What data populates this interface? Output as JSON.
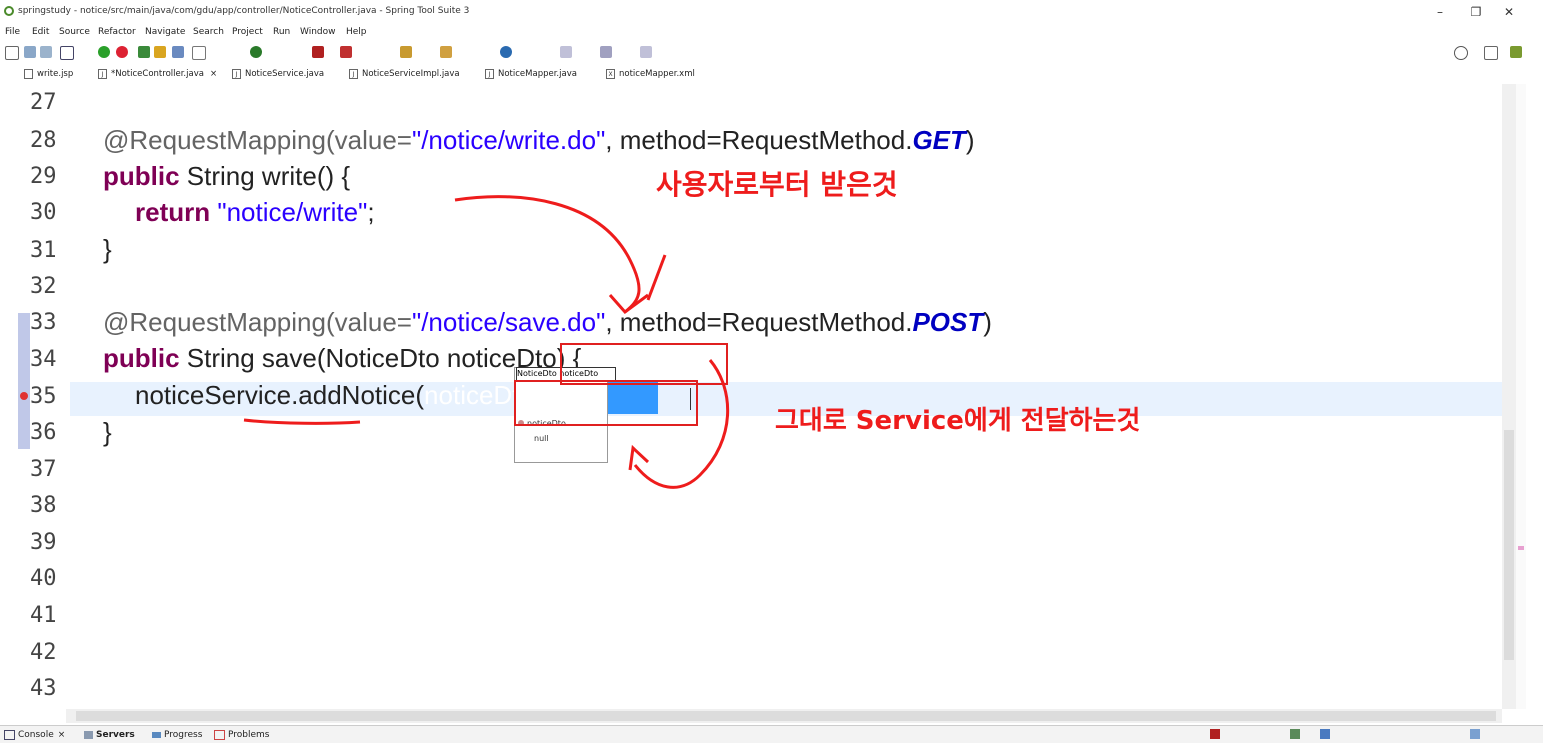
{
  "window": {
    "title": "springstudy - notice/src/main/java/com/gdu/app/controller/NoticeController.java - Spring Tool Suite 3",
    "controls": [
      "–",
      "❐",
      "✕"
    ]
  },
  "menu": [
    "File",
    "Edit",
    "Source",
    "Refactor",
    "Navigate",
    "Search",
    "Project",
    "Run",
    "Window",
    "Help"
  ],
  "tabs": [
    {
      "label": "write.jsp",
      "icon": "jsp-file-icon"
    },
    {
      "label": "*NoticeController.java",
      "icon": "java-file-icon",
      "close": "×"
    },
    {
      "label": "NoticeService.java",
      "icon": "java-file-icon"
    },
    {
      "label": "NoticeServiceImpl.java",
      "icon": "java-file-icon"
    },
    {
      "label": "NoticeMapper.java",
      "icon": "java-file-icon"
    },
    {
      "label": "noticeMapper.xml",
      "icon": "xml-file-icon"
    }
  ],
  "editor": {
    "line_numbers": [
      "27",
      "28",
      "29",
      "30",
      "31",
      "32",
      "33",
      "34",
      "35",
      "36",
      "37",
      "38",
      "39",
      "40",
      "41",
      "42",
      "43"
    ],
    "lines": {
      "l28": {
        "a": "@RequestMapping(value=",
        "s": "\"/notice/write.do\"",
        "b": ", method=RequestMethod.",
        "e": "GET",
        "c": ")"
      },
      "l29": {
        "k": "public",
        "rest": " String write() {"
      },
      "l30": {
        "k": "return",
        "s": "\"notice/write\"",
        "c": ";"
      },
      "l31": {
        "c": "}"
      },
      "l33": {
        "a": "@RequestMapping(value=",
        "s": "\"/notice/save.do\"",
        "b": ", method=RequestMethod.",
        "e": "POST",
        "c": ")"
      },
      "l34": {
        "k": "public",
        "rest": " String save(NoticeDto noticeDto) {"
      },
      "l35": {
        "a": "noticeService.addNotice(",
        "sel": "noticeDto",
        "c": ")"
      },
      "l36": {
        "c": "}"
      }
    },
    "tooltip": "NoticeDto noticeDto",
    "popup": [
      "noticeDto",
      "null"
    ]
  },
  "annotations": {
    "top": "사용자로부터 받은것",
    "bottom": "그대로 Service에게 전달하는것"
  },
  "bottom_tabs": [
    {
      "label": "Console",
      "close": "×"
    },
    {
      "label": "Servers"
    },
    {
      "label": "Progress"
    },
    {
      "label": "Problems"
    }
  ],
  "colors": {
    "keyword": "#7f0055",
    "string": "#2a00ff",
    "annotation_red": "#ee1c1c",
    "selection": "#3399ff"
  }
}
